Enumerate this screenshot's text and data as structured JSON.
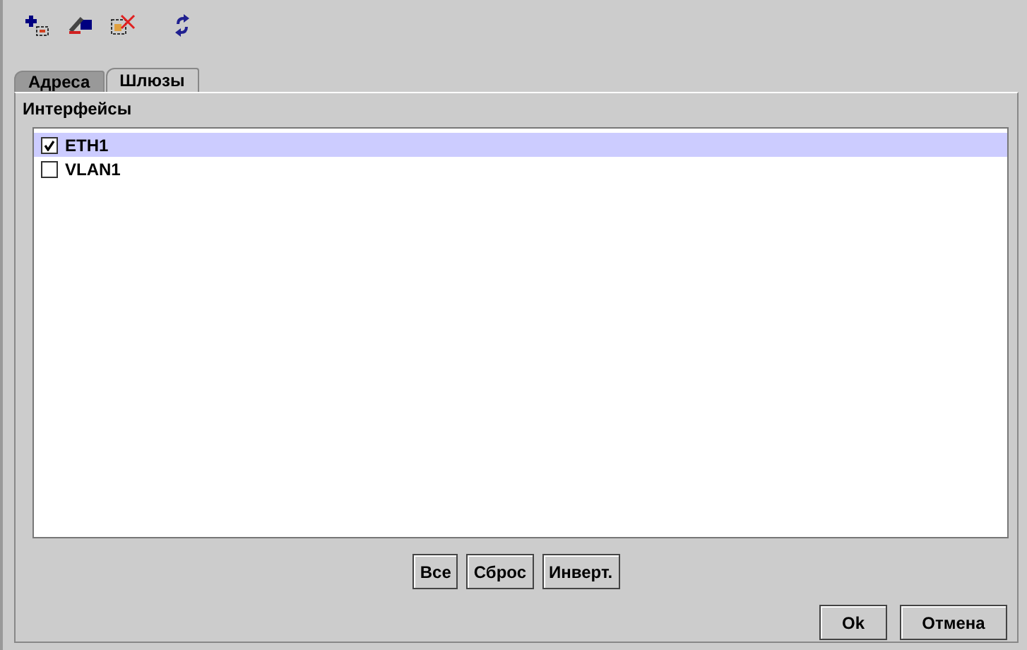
{
  "toolbar": {
    "buttons": [
      {
        "kind": "add"
      },
      {
        "kind": "edit"
      },
      {
        "kind": "delete"
      },
      {
        "kind": "refresh"
      }
    ]
  },
  "tabs": [
    {
      "label": "Адреса",
      "selected": false
    },
    {
      "label": "Шлюзы",
      "selected": true
    }
  ],
  "group": {
    "title": "Интерфейсы"
  },
  "list": [
    {
      "label": "ETH1",
      "checked": true,
      "selected": true
    },
    {
      "label": "VLAN1",
      "checked": false,
      "selected": false
    }
  ],
  "list_buttons": [
    "Все",
    "Сброс",
    "Инверт."
  ],
  "dialog_buttons": [
    "Ok",
    "Отмена"
  ]
}
